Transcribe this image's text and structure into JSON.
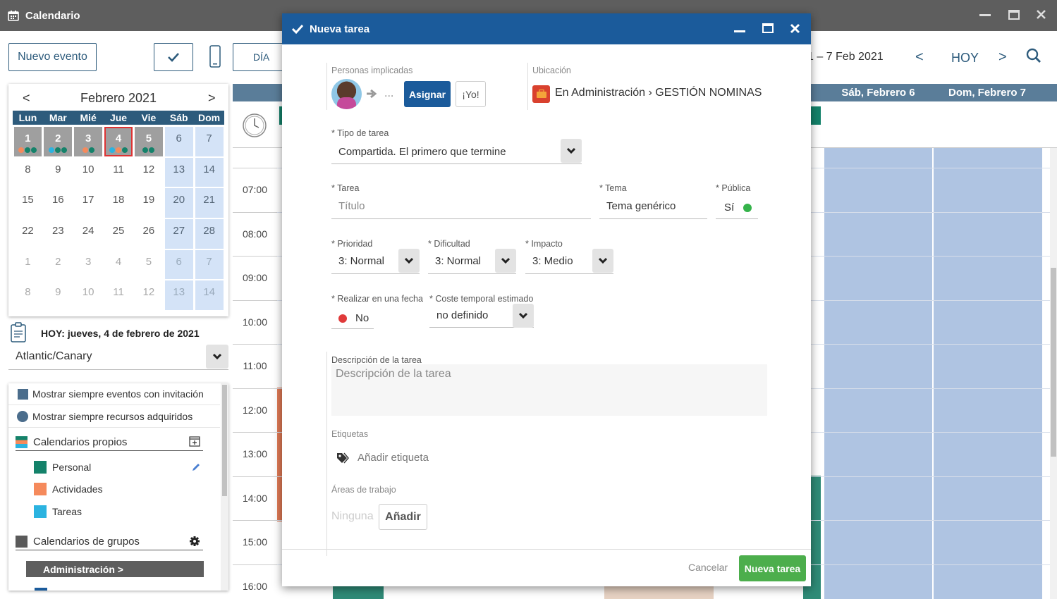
{
  "window": {
    "title": "Calendario"
  },
  "toolbar": {
    "new_event": "Nuevo evento",
    "view_day": "DÍA",
    "range": "1 – 7 Feb 2021",
    "prev": "<",
    "today": "HOY",
    "next": ">"
  },
  "mini_calendar": {
    "month": "Febrero 2021",
    "prev": "<",
    "next": ">",
    "weekdays": [
      "Lun",
      "Mar",
      "Mié",
      "Jue",
      "Vie",
      "Sáb",
      "Dom"
    ],
    "rows": [
      [
        "1",
        "2",
        "3",
        "4",
        "5",
        "6",
        "7"
      ],
      [
        "8",
        "9",
        "10",
        "11",
        "12",
        "13",
        "14"
      ],
      [
        "15",
        "16",
        "17",
        "18",
        "19",
        "20",
        "21"
      ],
      [
        "22",
        "23",
        "24",
        "25",
        "26",
        "27",
        "28"
      ],
      [
        "1",
        "2",
        "3",
        "4",
        "5",
        "6",
        "7"
      ],
      [
        "8",
        "9",
        "10",
        "11",
        "12",
        "13",
        "14"
      ]
    ]
  },
  "today_label": "HOY: jueves, 4 de febrero de 2021",
  "timezone": "Atlantic/Canary",
  "options": {
    "show_invites": "Mostrar siempre eventos con invitación",
    "show_resources": "Mostrar siempre recursos adquiridos",
    "own_calendars": "Calendarios propios",
    "own_items": [
      {
        "label": "Personal",
        "color": "#14826a"
      },
      {
        "label": "Actividades",
        "color": "#f58a5c"
      },
      {
        "label": "Tareas",
        "color": "#2bb3e0"
      }
    ],
    "group_calendars": "Calendarios de grupos",
    "group_selected": "Administración >"
  },
  "week": {
    "headers": [
      "Sáb, Febrero 6",
      "Dom, Febrero 7"
    ],
    "hours": [
      "07:00",
      "08:00",
      "09:00",
      "10:00",
      "11:00",
      "12:00",
      "13:00",
      "14:00",
      "15:00",
      "16:00"
    ]
  },
  "colors": {
    "accent": "#1b5b9b",
    "header_dark": "#5e5e5e",
    "weekend": "#afc4e2",
    "confirm": "#4cae4c",
    "toolbar": "#2d5b7c"
  },
  "modal": {
    "title": "Nueva tarea",
    "people_label": "Personas implicadas",
    "people_more": "...",
    "assign_btn": "Asignar",
    "me_btn": "¡Yo!",
    "location_label": "Ubicación",
    "location_value": "En Administración › GESTIÓN NOMINAS",
    "task_type_label": "Tipo de tarea",
    "task_type_value": "Compartida. El primero que termine",
    "task_label": "Tarea",
    "task_placeholder": "Título",
    "topic_label": "Tema",
    "topic_value": "Tema genérico",
    "public_label": "Pública",
    "public_value": "Sí",
    "priority_label": "Prioridad",
    "priority_value": "3: Normal",
    "difficulty_label": "Dificultad",
    "difficulty_value": "3: Normal",
    "impact_label": "Impacto",
    "impact_value": "3: Medio",
    "on_date_label": "Realizar en una fecha",
    "on_date_value": "No",
    "cost_label": "Coste temporal estimado",
    "cost_value": "no definido",
    "desc_label": "Descripción de la tarea",
    "desc_placeholder": "Descripción de la tarea",
    "tags_label": "Etiquetas",
    "tags_add": "Añadir etiqueta",
    "areas_label": "Áreas de trabajo",
    "areas_none": "Ninguna",
    "areas_add": "Añadir",
    "cancel": "Cancelar",
    "submit": "Nueva tarea"
  }
}
